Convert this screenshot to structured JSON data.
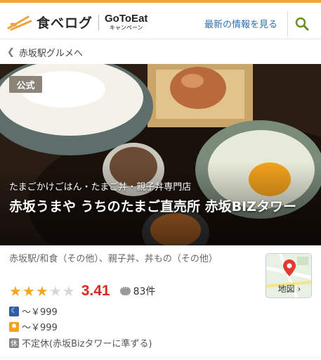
{
  "header": {
    "logo_text": "食べログ",
    "campaign_main": "GoToEat",
    "campaign_sub": "キャンペーン",
    "info_link": "最新の情報を見る",
    "accent_color": "#f2a23a"
  },
  "breadcrumb": {
    "label": "赤坂駅グルメへ"
  },
  "hero": {
    "badge": "公式",
    "subtitle": "たまごかけごはん・たまご丼・親子丼専門店",
    "title": "赤坂うまや うちのたまご直売所 赤坂BIZタワー"
  },
  "details": {
    "genre": "赤坂駅/和食（その他）、親子丼、丼もの（その他）",
    "rating": {
      "stars_filled": 3,
      "stars_total": 5,
      "score": "3.41",
      "score_color": "#d62b1e",
      "reviews": "83件"
    },
    "budget_dinner": "～￥999",
    "budget_lunch": "～￥999",
    "holiday_icon": "休",
    "holiday": "不定休(赤坂Bizタワーに準ずる)"
  },
  "map": {
    "label": "地図"
  },
  "icons": [
    "chopsticks-logo-icon",
    "search-icon",
    "chevron-left-icon",
    "star-icon",
    "comment-icon",
    "moon-icon",
    "sun-icon",
    "map-pin-icon",
    "chevron-right-icon"
  ]
}
